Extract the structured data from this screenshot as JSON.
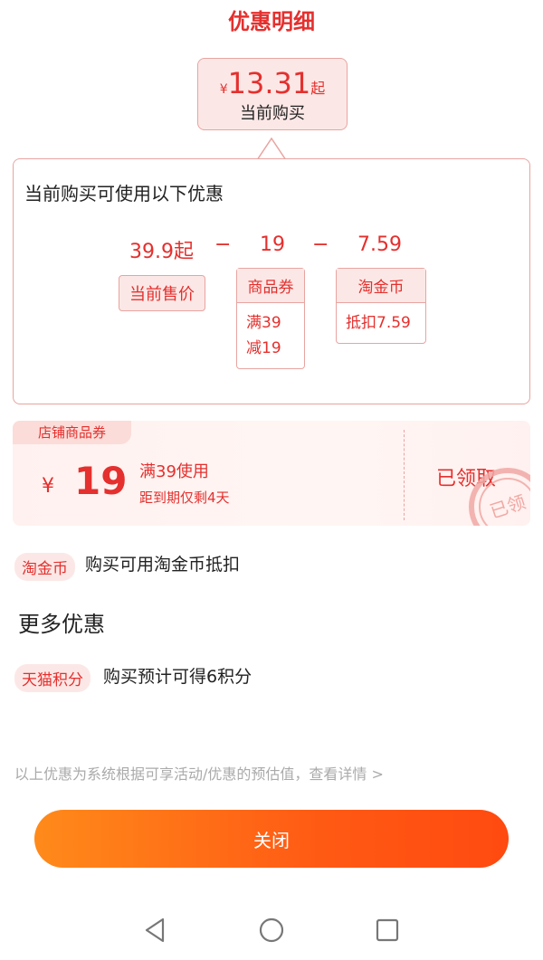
{
  "header": {
    "title": "优惠明细"
  },
  "summary": {
    "currency": "¥",
    "price": "13.31",
    "suffix": "起",
    "label": "当前购买"
  },
  "breakdown": {
    "title": "当前购买可使用以下优惠",
    "items": [
      {
        "value": "39.9起",
        "tag": "当前售价"
      },
      {
        "operator": "−"
      },
      {
        "value": "19",
        "tag": "商品券",
        "detail_lines": [
          "满39",
          "减19"
        ]
      },
      {
        "operator": "−"
      },
      {
        "value": "7.59",
        "tag": "淘金币",
        "detail_lines": [
          "抵扣7.59"
        ]
      }
    ]
  },
  "coupon": {
    "tag": "店铺商品券",
    "currency": "¥",
    "amount": "19",
    "condition": "满39使用",
    "expiry": "距到期仅剩4天",
    "status": "已领取",
    "stamp": "已领"
  },
  "taojinbi_row": {
    "tag": "淘金币",
    "text": "购买可用淘金币抵扣"
  },
  "more": {
    "title": "更多优惠"
  },
  "tmall_row": {
    "tag": "天猫积分",
    "text": "购买预计可得6积分"
  },
  "footnote": "以上优惠为系统根据可享活动/优惠的预估值，查看详情 >",
  "close_button": {
    "label": "关闭"
  },
  "navbar": {
    "icons": [
      "back-icon",
      "home-icon",
      "recents-icon"
    ]
  },
  "colors": {
    "accent": "#e4302e",
    "button_start": "#ff8a1a",
    "button_end": "#ff4a10",
    "tag_bg": "#fbe8e6"
  }
}
